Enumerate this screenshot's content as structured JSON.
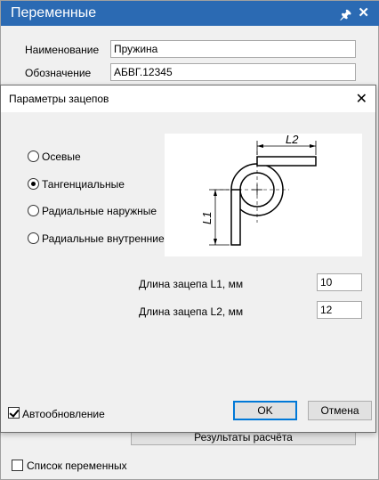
{
  "panel": {
    "title": "Переменные",
    "name_label": "Наименование",
    "name_value": "Пружина",
    "designation_label": "Обозначение",
    "designation_value": "АБВГ.12345",
    "results_button": "Результаты расчёта",
    "var_list_label": "Список переменных",
    "var_list_checked": false
  },
  "dialog": {
    "title": "Параметры зацепов",
    "options": [
      {
        "label": "Осевые",
        "selected": false
      },
      {
        "label": "Тангенциальные",
        "selected": true
      },
      {
        "label": "Радиальные наружные",
        "selected": false
      },
      {
        "label": "Радиальные внутренние",
        "selected": false
      }
    ],
    "diagram": {
      "l1": "L1",
      "l2": "L2"
    },
    "l1_label": "Длина зацепа L1, мм",
    "l1_value": "10",
    "l2_label": "Длина зацепа L2, мм",
    "l2_value": "12",
    "autoupdate_label": "Автообновление",
    "autoupdate_checked": true,
    "ok_label": "OK",
    "cancel_label": "Отмена"
  },
  "colors": {
    "accent": "#2b6ab3",
    "ok_border": "#0078d7"
  }
}
